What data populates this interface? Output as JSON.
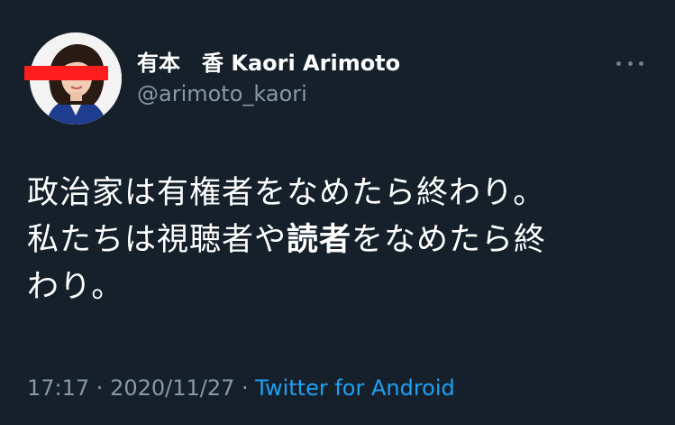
{
  "author": {
    "display_name": "有本　香  Kaori Arimoto",
    "handle": "@arimoto_kaori"
  },
  "tweet": {
    "line1": "政治家は有権者をなめたら終わり。",
    "line2_before": "私たちは視聴者や",
    "line2_bold": "読者",
    "line2_after": "をなめたら終",
    "line3": "わり。"
  },
  "meta": {
    "time": "17:17",
    "separator1": " · ",
    "date": "2020/11/27",
    "separator2": " · ",
    "source": "Twitter for Android"
  },
  "icons": {
    "more": "more-horizontal-icon"
  },
  "colors": {
    "background": "#15202b",
    "primary_text": "#ffffff",
    "secondary_text": "#8899a6",
    "link": "#1da1f2",
    "censor": "#ff1d1d"
  }
}
